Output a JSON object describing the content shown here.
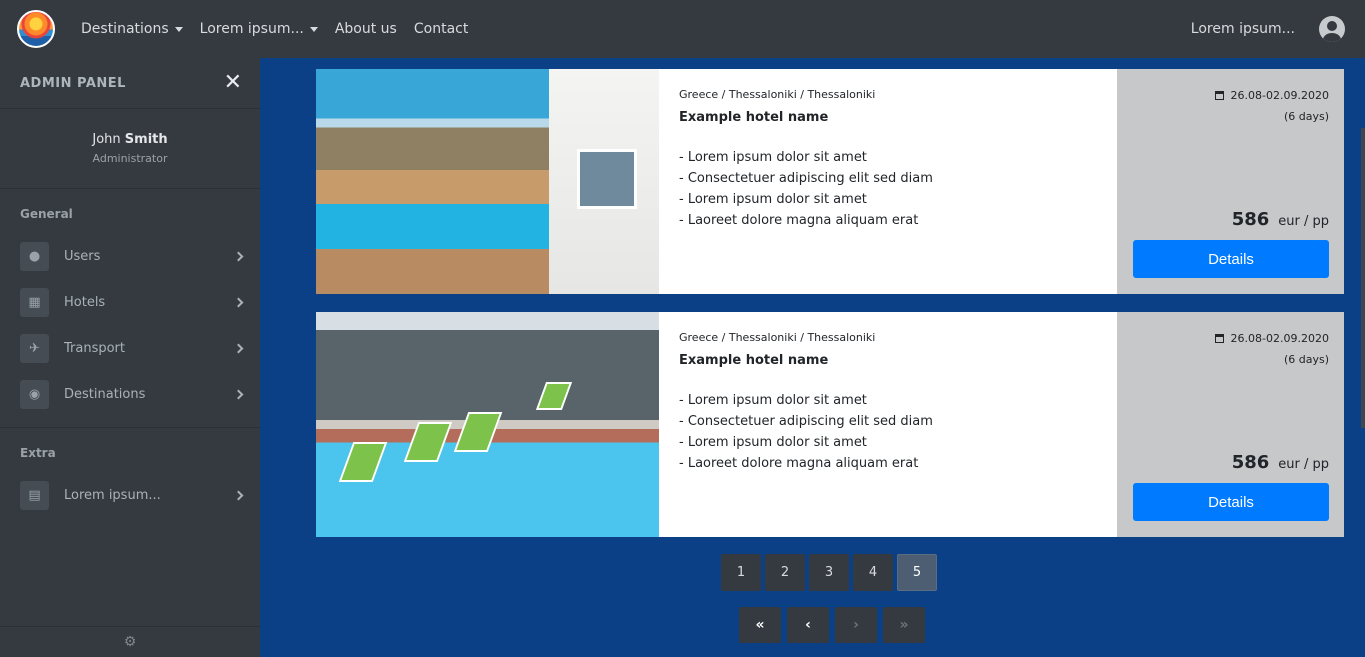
{
  "nav": {
    "links": [
      {
        "label": "Destinations",
        "dropdown": true
      },
      {
        "label": "Lorem ipsum...",
        "dropdown": true
      },
      {
        "label": "About us",
        "dropdown": false
      },
      {
        "label": "Contact",
        "dropdown": false
      }
    ],
    "user_label": "Lorem ipsum..."
  },
  "sidebar": {
    "title": "ADMIN PANEL",
    "profile": {
      "first": "John",
      "last": "Smith",
      "role": "Administrator"
    },
    "general_title": "General",
    "general_items": [
      {
        "label": "Users",
        "icon": "user-icon"
      },
      {
        "label": "Hotels",
        "icon": "building-icon"
      },
      {
        "label": "Transport",
        "icon": "plane-icon"
      },
      {
        "label": "Destinations",
        "icon": "map-pin-icon"
      }
    ],
    "extra_title": "Extra",
    "extra_items": [
      {
        "label": "Lorem ipsum...",
        "icon": "book-icon"
      }
    ]
  },
  "offers": [
    {
      "location": "Greece / Thessaloniki / Thessaloniki",
      "hotel": "Example hotel name",
      "features": [
        "Lorem ipsum dolor sit amet",
        "Consectetuer adipiscing elit sed diam",
        "Lorem ipsum dolor sit amet",
        "Laoreet dolore magna aliquam erat"
      ],
      "dates": "26.08-02.09.2020",
      "days": "(6 days)",
      "price": "586",
      "price_unit": "eur / pp",
      "button": "Details"
    },
    {
      "location": "Greece / Thessaloniki / Thessaloniki",
      "hotel": "Example hotel name",
      "features": [
        "Lorem ipsum dolor sit amet",
        "Consectetuer adipiscing elit sed diam",
        "Lorem ipsum dolor sit amet",
        "Laoreet dolore magna aliquam erat"
      ],
      "dates": "26.08-02.09.2020",
      "days": "(6 days)",
      "price": "586",
      "price_unit": "eur / pp",
      "button": "Details"
    }
  ],
  "pagination": {
    "pages": [
      "1",
      "2",
      "3",
      "4",
      "5"
    ],
    "active": "5",
    "first": "«",
    "prev": "‹",
    "next": "›",
    "last": "»"
  },
  "colors": {
    "accent": "#007bff",
    "dark": "#343a40",
    "side_panel": "#c6c8ca"
  }
}
